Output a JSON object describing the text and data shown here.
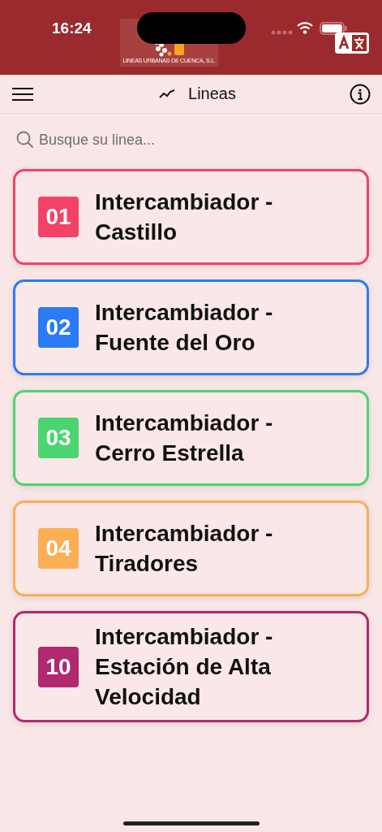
{
  "status_bar": {
    "time": "16:24"
  },
  "logo": {
    "subtitle": "LINEAS URBANAS DE CUENCA, S.L."
  },
  "toolbar": {
    "title": "Lineas"
  },
  "search": {
    "placeholder": "Busque su linea..."
  },
  "lines": [
    {
      "number": "01",
      "name": "Intercambiador - Castillo",
      "color": "#f24268"
    },
    {
      "number": "02",
      "name": "Intercambiador - Fuente del Oro",
      "color": "#2a7bf4"
    },
    {
      "number": "03",
      "name": "Intercambiador - Cerro Estrella",
      "color": "#4cd471"
    },
    {
      "number": "04",
      "name": "Intercambiador - Tiradores",
      "color": "#fcae55"
    },
    {
      "number": "10",
      "name": "Intercambiador - Estación de Alta Velocidad",
      "color": "#b0296f"
    }
  ]
}
